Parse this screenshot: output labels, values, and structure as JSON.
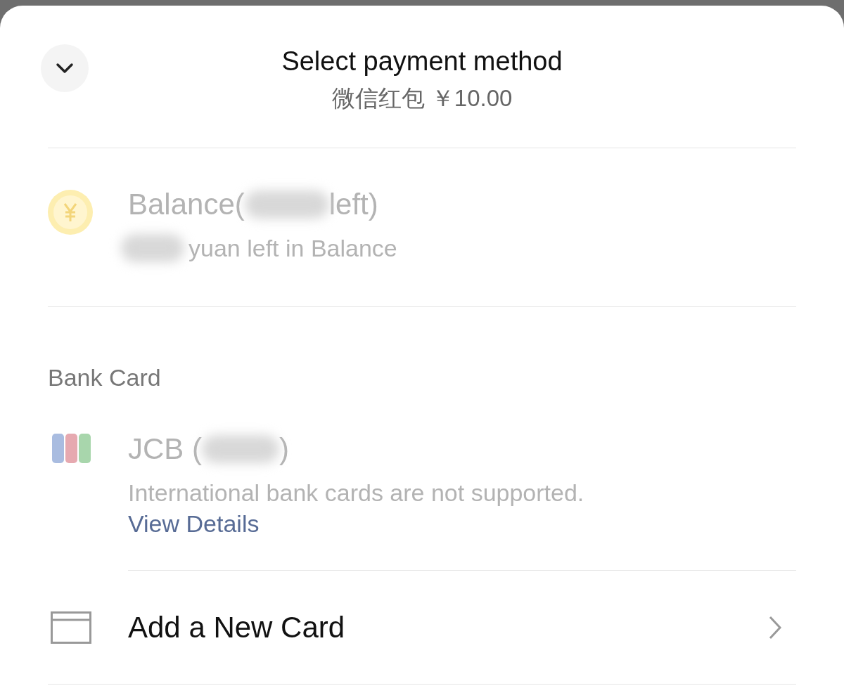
{
  "header": {
    "title": "Select payment method",
    "subtitle": "微信红包 ￥10.00"
  },
  "methods": [
    {
      "kind": "balance",
      "title_start": "Balance(",
      "title_end": "left)",
      "note": "yuan left in Balance",
      "disabled": true
    }
  ],
  "bank_section": {
    "label": "Bank Card",
    "cards": [
      {
        "kind": "jcb",
        "title_start": "JCB (",
        "title_end": ")",
        "note": "International bank cards are not supported.",
        "link": "View Details",
        "disabled": true
      }
    ],
    "add_card": {
      "label": "Add a New Card"
    }
  }
}
